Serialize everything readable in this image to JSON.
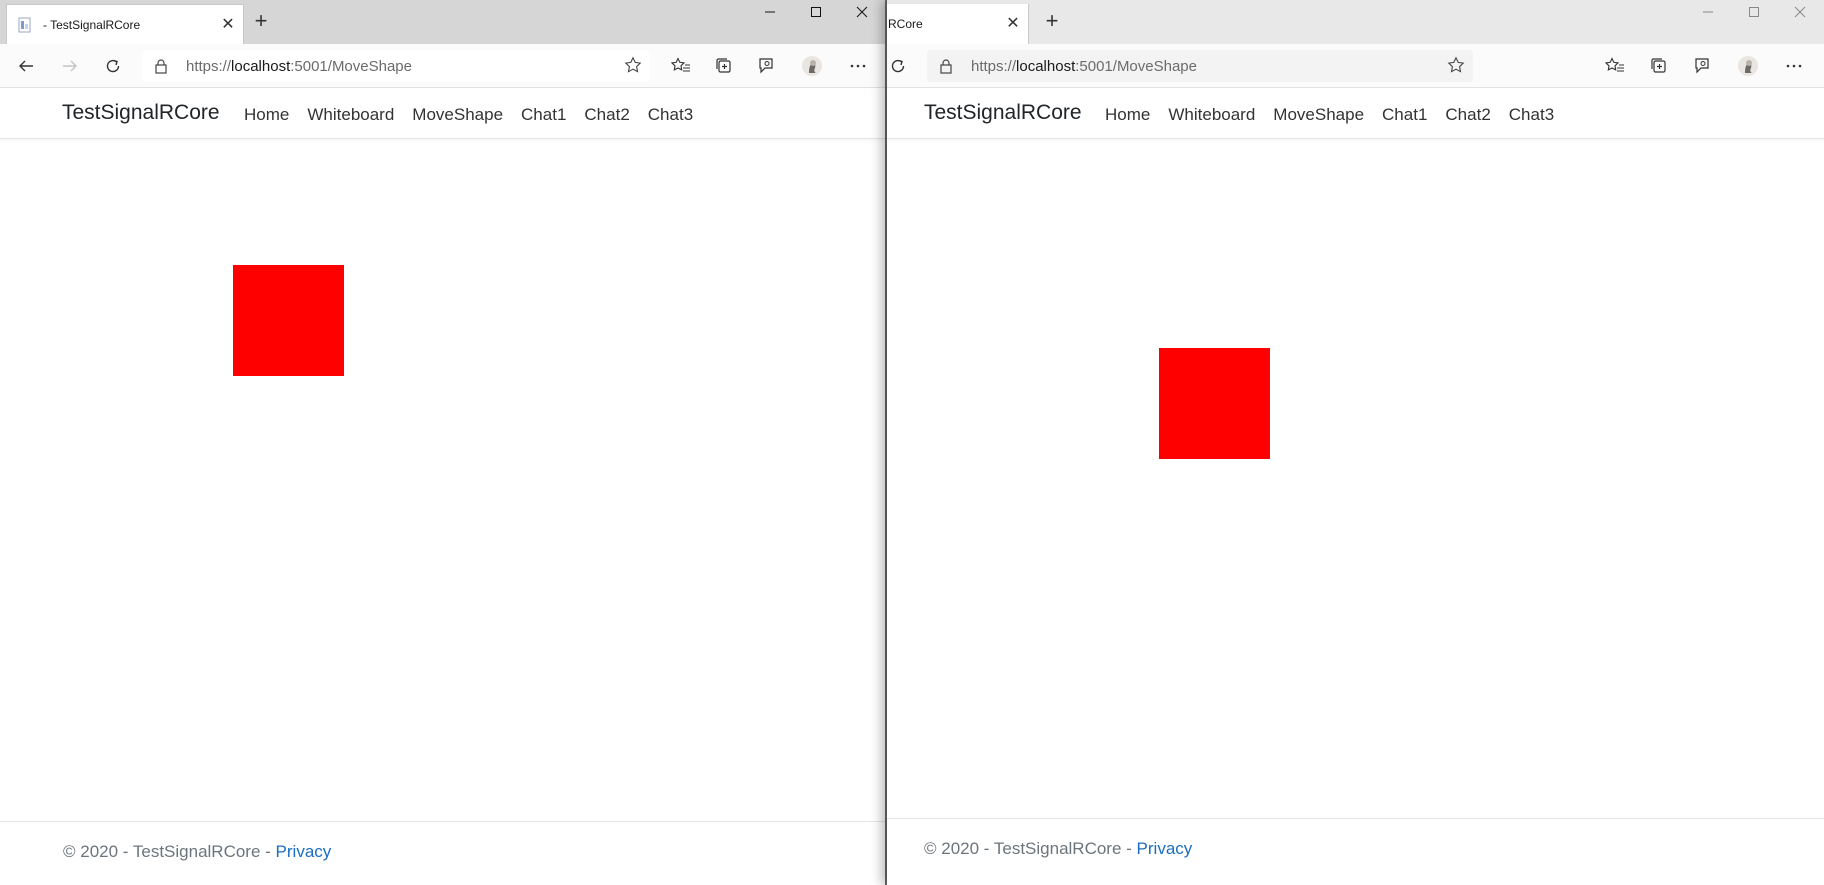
{
  "left_window": {
    "tab_title": "- TestSignalRCore",
    "url_scheme": "https://",
    "url_host": "localhost",
    "url_rest": ":5001/MoveShape",
    "brand": "TestSignalRCore",
    "nav": [
      "Home",
      "Whiteboard",
      "MoveShape",
      "Chat1",
      "Chat2",
      "Chat3"
    ],
    "footer_prefix": "© 2020 - TestSignalRCore - ",
    "footer_link": "Privacy"
  },
  "right_window": {
    "tab_title": "RCore",
    "url_scheme": "https://",
    "url_host": "localhost",
    "url_rest": ":5001/MoveShape",
    "brand": "TestSignalRCore",
    "nav": [
      "Home",
      "Whiteboard",
      "MoveShape",
      "Chat1",
      "Chat2",
      "Chat3"
    ],
    "footer_prefix": "© 2020 - TestSignalRCore - ",
    "footer_link": "Privacy"
  },
  "icons": {
    "back": "back-arrow-icon",
    "forward": "forward-arrow-icon",
    "refresh": "refresh-icon",
    "lock": "lock-icon",
    "star": "star-icon",
    "favorites": "favorites-icon",
    "collections": "collections-icon",
    "feedback": "feedback-icon",
    "profile": "profile-avatar-icon",
    "more": "more-icon"
  },
  "colors": {
    "shape": "#ff0000",
    "link": "#1b6ec2"
  }
}
